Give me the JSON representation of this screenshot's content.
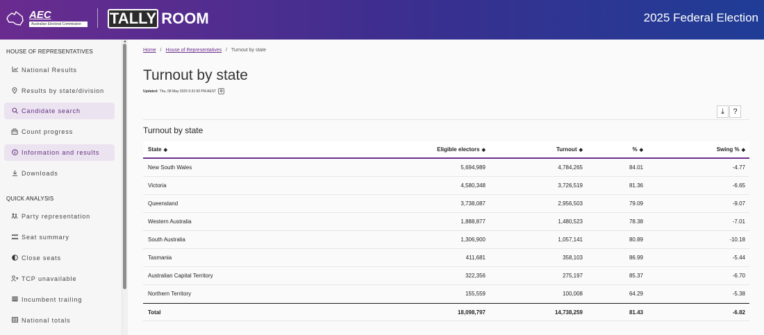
{
  "header": {
    "aec_abbr": "AEC",
    "aec_full": "Australian Electoral Commission",
    "tally": "TALLY",
    "room": "ROOM",
    "election": "2025 Federal Election"
  },
  "sidebar": {
    "section1": "HOUSE OF REPRESENTATIVES",
    "items1": [
      {
        "label": "National Results",
        "icon": "chart-icon"
      },
      {
        "label": "Results by state/division",
        "icon": "location-pin-icon"
      },
      {
        "label": "Candidate search",
        "icon": "search-icon",
        "active": true
      },
      {
        "label": "Count progress",
        "icon": "ballot-box-icon"
      },
      {
        "label": "Information and results",
        "icon": "info-icon",
        "active": true
      },
      {
        "label": "Downloads",
        "icon": "download-icon"
      }
    ],
    "section2": "QUICK ANALYSIS",
    "items2": [
      {
        "label": "Party representation",
        "icon": "party-icon"
      },
      {
        "label": "Seat summary",
        "icon": "people-icon"
      },
      {
        "label": "Close seats",
        "icon": "contrast-icon"
      },
      {
        "label": "TCP unavailable",
        "icon": "user-x-icon"
      },
      {
        "label": "Incumbent trailing",
        "icon": "list-icon"
      },
      {
        "label": "National totals",
        "icon": "grid-icon"
      }
    ]
  },
  "breadcrumb": {
    "home": "Home",
    "sep": "/",
    "house": "House of Representatives",
    "current": "Turnout by state"
  },
  "page": {
    "title": "Turnout by state",
    "updated_label": "Updated:",
    "updated_value": "Thu, 08 May 2025 5:31:50 PM AEST",
    "table_title": "Turnout by state"
  },
  "toolbar": {
    "download": "⤓",
    "help": "?"
  },
  "table": {
    "headers": [
      "State",
      "Eligible electors",
      "Turnout",
      "%",
      "Swing %"
    ],
    "sort_glyph": "◆",
    "rows": [
      [
        "New South Wales",
        "5,694,989",
        "4,784,265",
        "84.01",
        "-4.77"
      ],
      [
        "Victoria",
        "4,580,348",
        "3,726,519",
        "81.36",
        "-6.65"
      ],
      [
        "Queensland",
        "3,738,087",
        "2,956,503",
        "79.09",
        "-9.07"
      ],
      [
        "Western Australia",
        "1,888,877",
        "1,480,523",
        "78.38",
        "-7.01"
      ],
      [
        "South Australia",
        "1,306,900",
        "1,057,141",
        "80.89",
        "-10.18"
      ],
      [
        "Tasmania",
        "411,681",
        "358,103",
        "86.99",
        "-5.44"
      ],
      [
        "Australian Capital Territory",
        "322,356",
        "275,197",
        "85.37",
        "-6.70"
      ],
      [
        "Northern Territory",
        "155,559",
        "100,008",
        "64.29",
        "-5.38"
      ]
    ],
    "total": [
      "Total",
      "18,098,797",
      "14,738,259",
      "81.43",
      "-6.82"
    ]
  }
}
